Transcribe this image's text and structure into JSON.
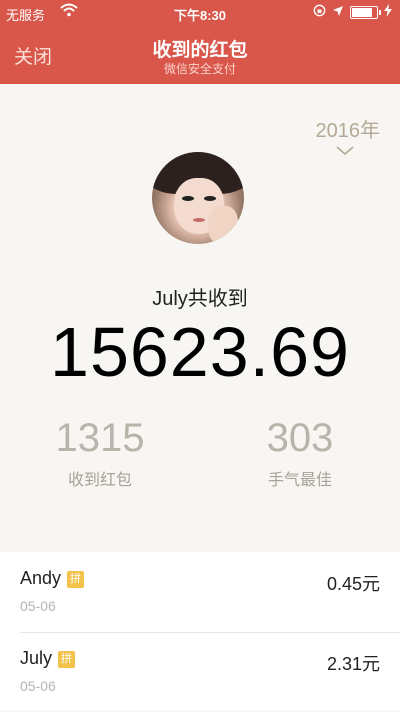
{
  "status": {
    "carrier": "无服务",
    "time": "下午8:30",
    "battery_level": 0.85
  },
  "nav": {
    "close_label": "关闭",
    "title": "收到的红包",
    "subtitle": "微信安全支付"
  },
  "year": "2016年",
  "summary": {
    "label": "July共收到",
    "amount": "15623.69"
  },
  "stats": [
    {
      "value": "1315",
      "label": "收到红包"
    },
    {
      "value": "303",
      "label": "手气最佳"
    }
  ],
  "records": [
    {
      "name": "Andy",
      "badge": "拼",
      "date": "05-06",
      "amount": "0.45元"
    },
    {
      "name": "July",
      "badge": "拼",
      "date": "05-06",
      "amount": "2.31元"
    }
  ],
  "colors": {
    "brand_red": "#d8564a",
    "badge_gold": "#f2c24a"
  }
}
